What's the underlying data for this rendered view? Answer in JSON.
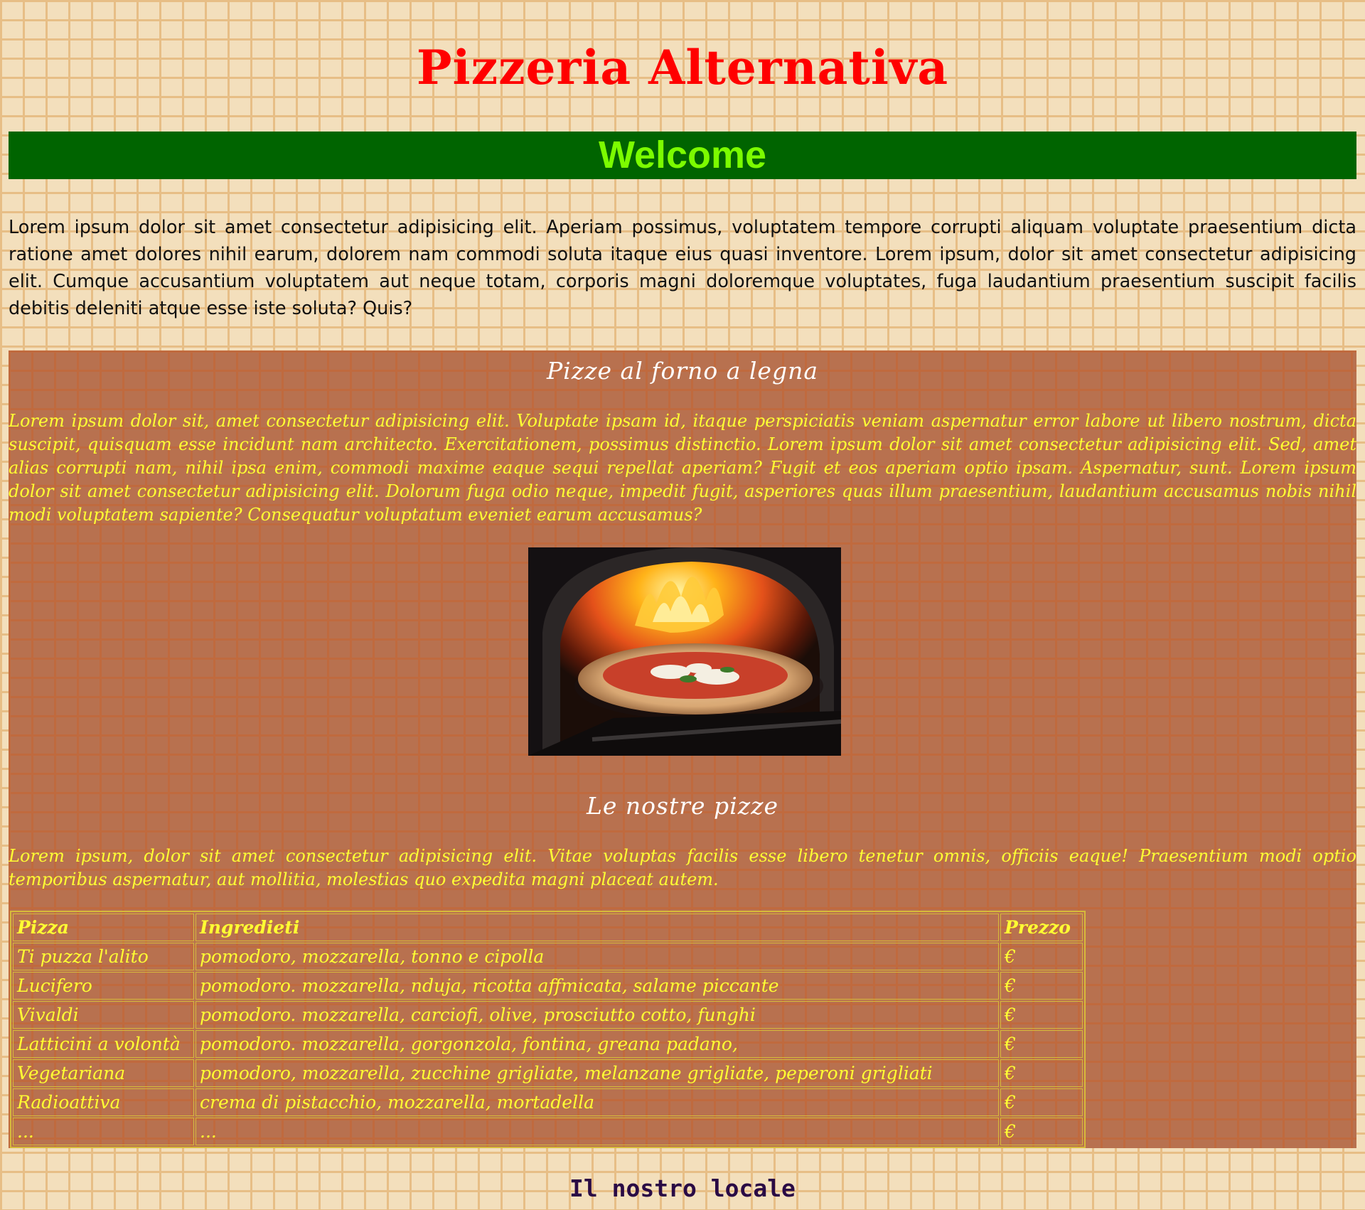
{
  "header": {
    "title": "Pizzeria Alternativa",
    "welcome": "Welcome"
  },
  "intro": "Lorem ipsum dolor sit amet consectetur adipisicing elit. Aperiam possimus, voluptatem tempore corrupti aliquam voluptate praesentium dicta ratione amet dolores nihil earum, dolorem nam commodi soluta itaque eius quasi inventore. Lorem ipsum, dolor sit amet consectetur adipisicing elit. Cumque accusantium voluptatem aut neque totam, corporis magni doloremque voluptates, fuga laudantium praesentium suscipit facilis debitis deleniti atque esse iste soluta? Quis?",
  "section_oven": {
    "heading": "Pizze al forno a legna",
    "text": "Lorem ipsum dolor sit, amet consectetur adipisicing elit. Voluptate ipsam id, itaque perspiciatis veniam aspernatur error labore ut libero nostrum, dicta suscipit, quisquam esse incidunt nam architecto. Exercitationem, possimus distinctio. Lorem ipsum dolor sit amet consectetur adipisicing elit. Sed, amet alias corrupti nam, nihil ipsa enim, commodi maxime eaque sequi repellat aperiam? Fugit et eos aperiam optio ipsam. Aspernatur, sunt. Lorem ipsum dolor sit amet consectetur adipisicing elit. Dolorum fuga odio neque, impedit fugit, asperiores quas illum praesentium, laudantium accusamus nobis nihil modi voluptatem sapiente? Consequatur voluptatum eveniet earum accusamus?",
    "image_icon": "pizza-oven-photo"
  },
  "section_menu": {
    "heading": "Le nostre pizze",
    "text": "Lorem ipsum, dolor sit amet consectetur adipisicing elit. Vitae voluptas facilis esse libero tenetur omnis, officiis eaque! Praesentium modi optio temporibus aspernatur, aut mollitia, molestias quo expedita magni placeat autem."
  },
  "menu_table": {
    "headers": [
      "Pizza",
      "Ingredieti",
      "Prezzo"
    ],
    "rows": [
      [
        "Ti puzza l'alito",
        "pomodoro, mozzarella, tonno e cipolla",
        "€"
      ],
      [
        "Lucifero",
        "pomodoro. mozzarella, nduja, ricotta affmicata, salame piccante",
        "€"
      ],
      [
        "Vivaldi",
        "pomodoro. mozzarella, carciofi, olive, prosciutto cotto, funghi",
        "€"
      ],
      [
        "Latticini a volontà",
        "pomodoro. mozzarella, gorgonzola, fontina, greana padano,",
        "€"
      ],
      [
        "Vegetariana",
        "pomodoro, mozzarella, zucchine grigliate, melanzane grigliate, peperoni grigliati",
        "€"
      ],
      [
        "Radioattiva",
        "crema di pistacchio, mozzarella, mortadella",
        "€"
      ],
      [
        "...",
        "...",
        "€"
      ]
    ]
  },
  "footer": {
    "heading": "Il nostro locale"
  },
  "colors": {
    "title": "#ff0000",
    "welcome_bg": "#006400",
    "welcome_text": "#7cfc00",
    "section_bg": "#b8714f",
    "section_text": "#ffff33",
    "footer_text": "#2a0a45"
  }
}
